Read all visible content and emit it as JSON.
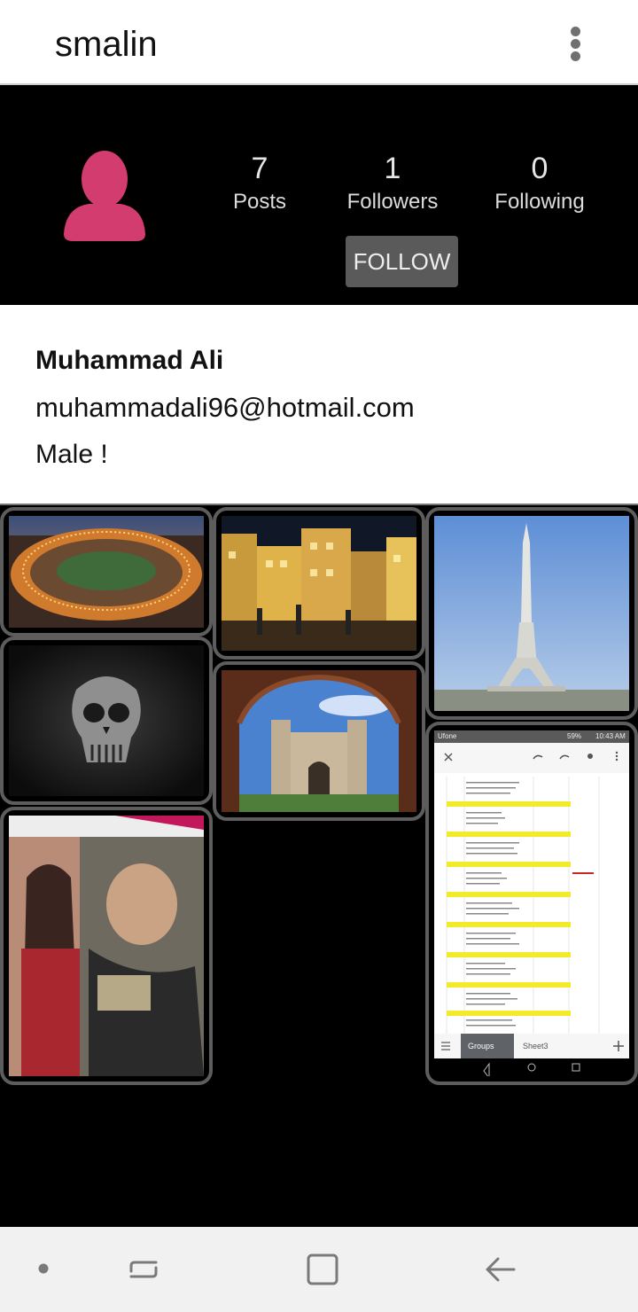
{
  "app": {
    "title": "smalin"
  },
  "profile": {
    "stats": [
      {
        "value": "7",
        "label": "Posts"
      },
      {
        "value": "1",
        "label": "Followers"
      },
      {
        "value": "0",
        "label": "Following"
      }
    ],
    "follow_label": "FOLLOW",
    "name": "Muhammad Ali",
    "email": "muhammadali96@hotmail.com",
    "gender": "Male !"
  },
  "posts": [
    {
      "icon": "roundabout-city-photo"
    },
    {
      "icon": "night-street-photo"
    },
    {
      "icon": "minar-tower-photo"
    },
    {
      "icon": "skull-photo"
    },
    {
      "icon": "fort-arch-photo"
    },
    {
      "icon": "magazines-photo"
    },
    {
      "icon": "spreadsheet-screenshot-photo"
    }
  ],
  "spreadsheet": {
    "carrier": "Ufone",
    "status": "59%",
    "time": "10:43 AM",
    "tab_active": "Groups",
    "tab_other": "Sheet3"
  },
  "colors": {
    "avatar": "#d23c6e",
    "header_bg": "#000000",
    "button_bg": "#5a5a5a"
  }
}
